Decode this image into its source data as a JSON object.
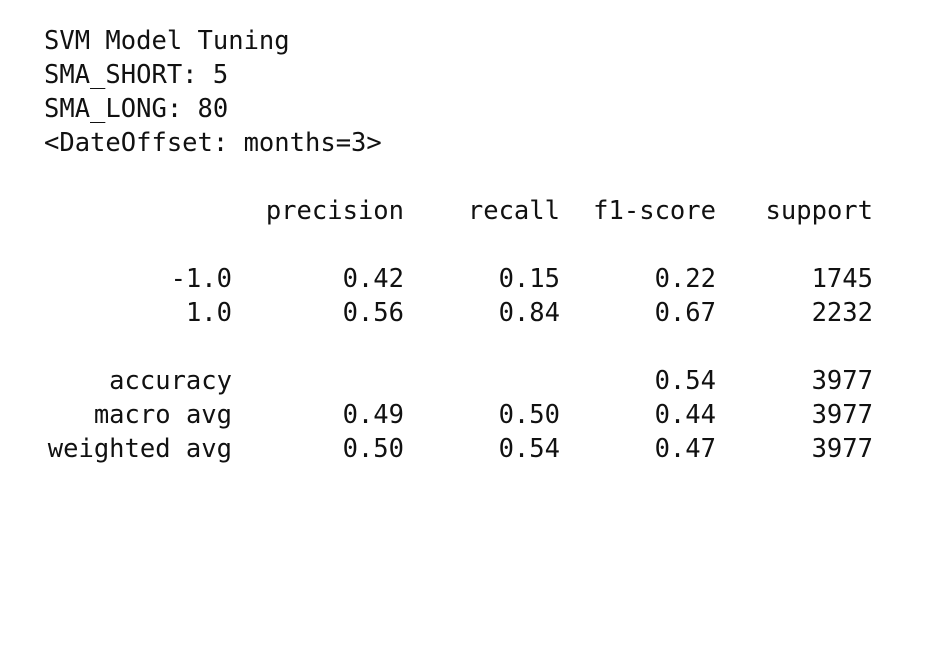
{
  "header_lines": [
    "SVM Model Tuning",
    "SMA_SHORT: 5",
    "SMA_LONG: 80",
    "<DateOffset: months=3>"
  ],
  "report": {
    "columns": [
      "precision",
      "recall",
      "f1-score",
      "support"
    ],
    "class_rows": [
      {
        "label": "-1.0",
        "precision": "0.42",
        "recall": "0.15",
        "f1": "0.22",
        "support": "1745"
      },
      {
        "label": "1.0",
        "precision": "0.56",
        "recall": "0.84",
        "f1": "0.67",
        "support": "2232"
      }
    ],
    "summary_rows": [
      {
        "label": "accuracy",
        "precision": "",
        "recall": "",
        "f1": "0.54",
        "support": "3977"
      },
      {
        "label": "macro avg",
        "precision": "0.49",
        "recall": "0.50",
        "f1": "0.44",
        "support": "3977"
      },
      {
        "label": "weighted avg",
        "precision": "0.50",
        "recall": "0.54",
        "f1": "0.47",
        "support": "3977"
      }
    ]
  }
}
